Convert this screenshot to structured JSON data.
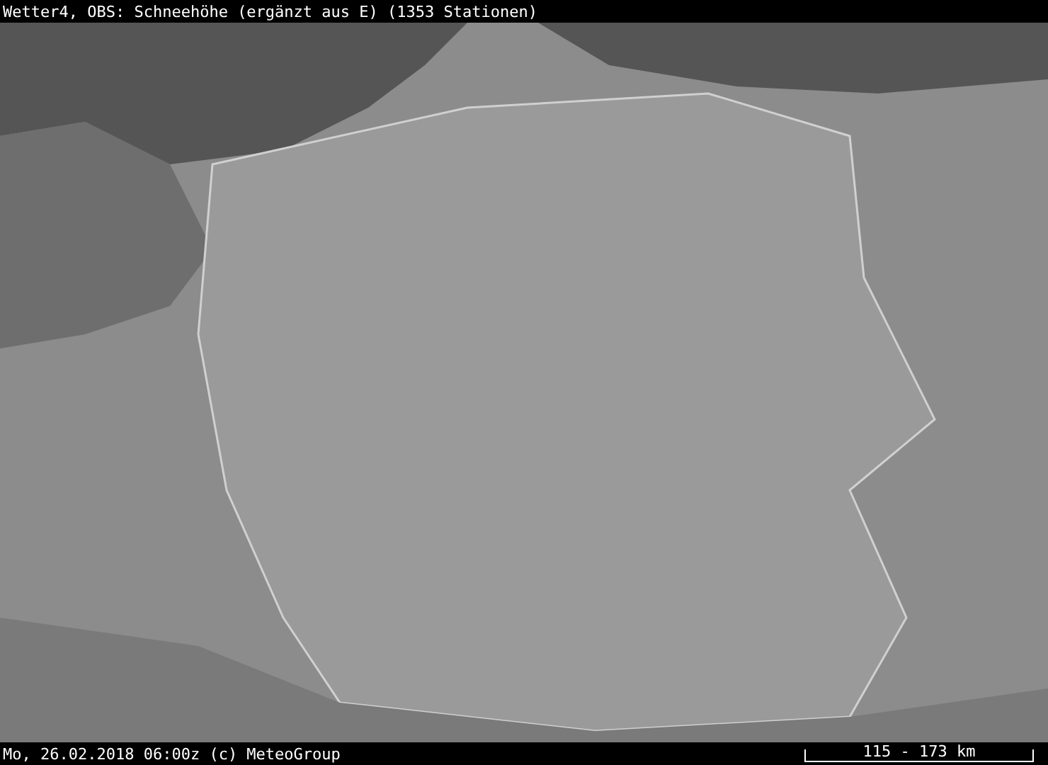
{
  "title": "Wetter4, OBS: Schneehöhe (ergänzt aus E) (1353 Stationen)",
  "map": {
    "kind": "snow-depth-station-map"
  },
  "footer": {
    "timestamp": "Mo, 26.02.2018 06:00z (c) MeteoGroup",
    "scale": "115 - 173 km"
  }
}
